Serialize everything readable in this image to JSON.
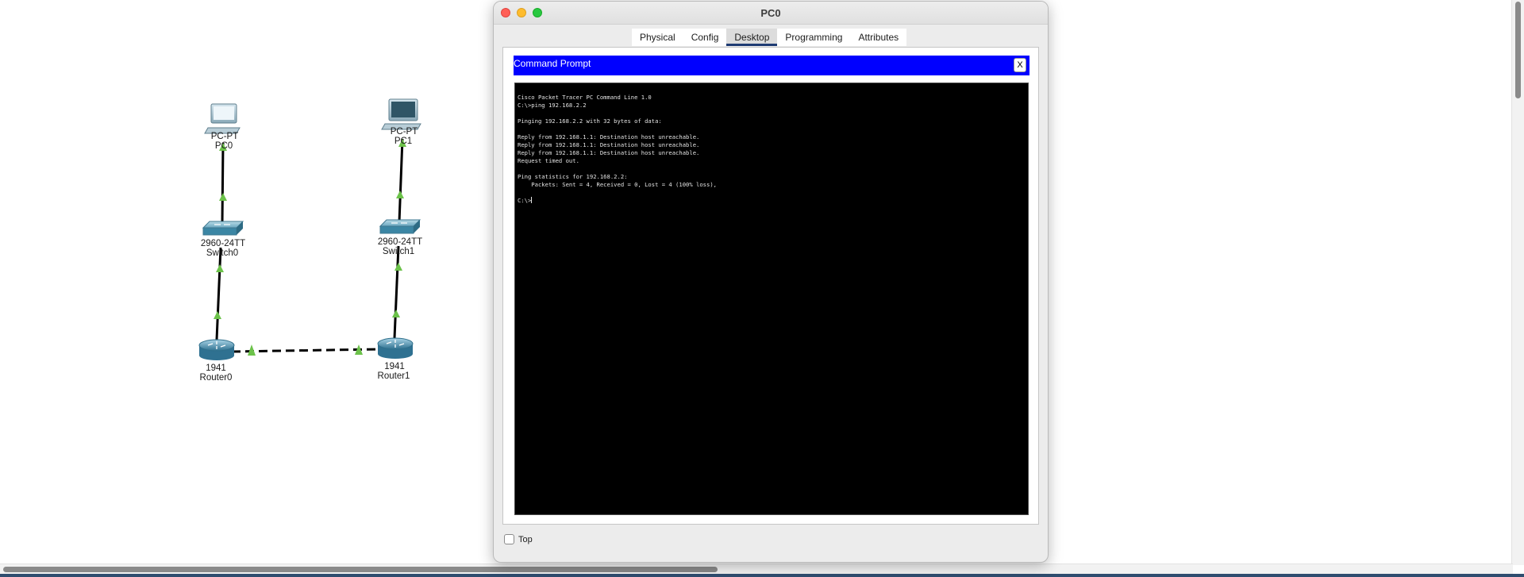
{
  "topology": {
    "devices": [
      {
        "id": "pc0",
        "model": "PC-PT",
        "name": "PC0",
        "icon": "pc-icon"
      },
      {
        "id": "pc1",
        "model": "PC-PT",
        "name": "PC1",
        "icon": "pc-icon"
      },
      {
        "id": "switch0",
        "model": "2960-24TT",
        "name": "Switch0",
        "icon": "switch-icon"
      },
      {
        "id": "switch1",
        "model": "2960-24TT",
        "name": "Switch1",
        "icon": "switch-icon"
      },
      {
        "id": "router0",
        "model": "1941",
        "name": "Router0",
        "icon": "router-icon"
      },
      {
        "id": "router1",
        "model": "1941",
        "name": "Router1",
        "icon": "router-icon"
      }
    ],
    "link_light_color": "#6cc24a"
  },
  "window": {
    "title": "PC0",
    "tabs": [
      {
        "label": "Physical",
        "active": false
      },
      {
        "label": "Config",
        "active": false
      },
      {
        "label": "Desktop",
        "active": true
      },
      {
        "label": "Programming",
        "active": false
      },
      {
        "label": "Attributes",
        "active": false
      }
    ],
    "command_prompt": {
      "title": "Command Prompt",
      "close_label": "X",
      "header_color": "#0000ff",
      "lines": [
        "Cisco Packet Tracer PC Command Line 1.0",
        "C:\\>ping 192.168.2.2",
        "",
        "Pinging 192.168.2.2 with 32 bytes of data:",
        "",
        "Reply from 192.168.1.1: Destination host unreachable.",
        "Reply from 192.168.1.1: Destination host unreachable.",
        "Reply from 192.168.1.1: Destination host unreachable.",
        "Request timed out.",
        "",
        "Ping statistics for 192.168.2.2:",
        "    Packets: Sent = 4, Received = 0, Lost = 4 (100% loss),",
        "",
        "C:\\>"
      ]
    },
    "top_checkbox_label": "Top",
    "top_checked": false
  }
}
